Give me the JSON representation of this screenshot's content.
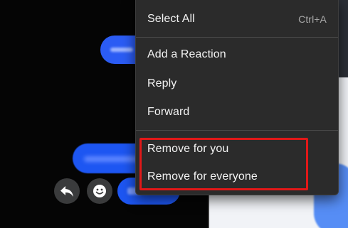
{
  "colors": {
    "menu_bg": "#2b2b2b",
    "bubble_blue": "#1f5cf0",
    "highlight_red": "#e21818",
    "shortcut_text": "#a9a9a9"
  },
  "chat": {
    "action_icons": {
      "reply": "reply-arrow-icon",
      "react": "smiley-icon"
    }
  },
  "context_menu": {
    "items": [
      {
        "label": "Select All",
        "shortcut": "Ctrl+A"
      },
      {
        "label": "Add a Reaction",
        "shortcut": ""
      },
      {
        "label": "Reply",
        "shortcut": ""
      },
      {
        "label": "Forward",
        "shortcut": ""
      },
      {
        "label": "Remove for you",
        "shortcut": ""
      },
      {
        "label": "Remove for everyone",
        "shortcut": ""
      }
    ]
  }
}
